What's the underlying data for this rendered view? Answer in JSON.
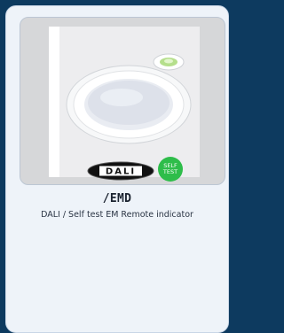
{
  "product": {
    "title": "/EMD",
    "subtitle": "DALI / Self test EM Remote indicator"
  },
  "image": {
    "badge_dali": "DALI",
    "badge_self_test": "SELF TEST"
  },
  "colors": {
    "page_bg": "#0d3a5f",
    "card_bg": "#eef3f9",
    "badge_green": "#2ebd4a",
    "badge_black": "#111111"
  }
}
